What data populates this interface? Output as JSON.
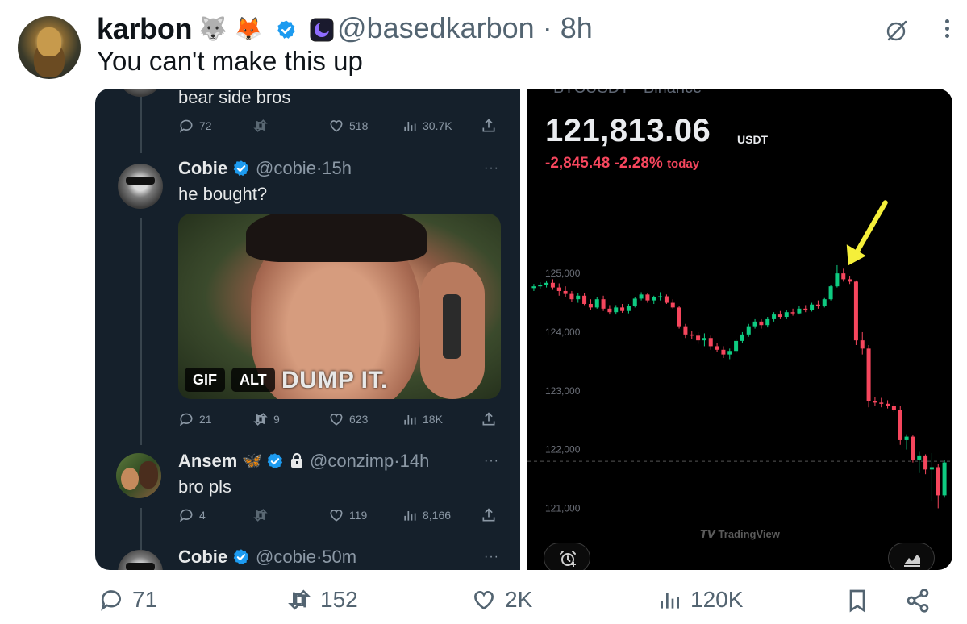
{
  "tweet": {
    "display_name": "karbon",
    "emojis": [
      "🐺",
      "🦊"
    ],
    "handle": "@basedkarbon",
    "separator": "·",
    "time": "8h",
    "text": "You can't make this up",
    "actions": {
      "replies": "71",
      "reposts": "152",
      "likes": "2K",
      "views": "120K"
    },
    "icons": [
      "grok-icon",
      "more-icon",
      "reply-icon",
      "repost-icon",
      "like-icon",
      "views-icon",
      "bookmark-icon",
      "share-icon"
    ]
  },
  "left_panel": {
    "top_reply": {
      "text": "bear side bros",
      "replies": "72",
      "reposts": "",
      "likes": "518",
      "views": "30.7K"
    },
    "reply_cobie": {
      "name": "Cobie",
      "handle": "@cobie",
      "time": "15h",
      "text": "he bought?",
      "gif_badge": "GIF",
      "alt_badge": "ALT",
      "gif_caption": "DUMP IT.",
      "replies": "21",
      "reposts": "9",
      "likes": "623",
      "views": "18K"
    },
    "reply_ansem": {
      "name": "Ansem",
      "name_emoji": "🦋",
      "handle": "@conzimp",
      "time": "14h",
      "text": "bro pls",
      "replies": "4",
      "reposts": "",
      "likes": "119",
      "views": "8,166"
    },
    "reply_cobie_2": {
      "name": "Cobie",
      "handle": "@cobie",
      "time": "50m"
    },
    "more_dots": "···",
    "separator": "·"
  },
  "right_panel": {
    "top_cut_text": "BTCUSDT · Binance",
    "price": "121,813.06",
    "unit": "USDT",
    "change_abs": "-2,845.48",
    "change_pct": "-2.28%",
    "change_label": "today",
    "watermark": "TradingView",
    "accent_colors": {
      "up": "#0ecb81",
      "down": "#f6465d",
      "arrow": "#f5ef3a"
    }
  },
  "chart_data": {
    "type": "candlestick",
    "title": "",
    "ylabel": "",
    "yticks": [
      "125,000",
      "124,000",
      "123,000",
      "122,000",
      "121,000"
    ],
    "ylim": [
      120800,
      125400
    ],
    "reference_line": 121800,
    "grid": false,
    "annotation": "yellow arrow pointing at local top",
    "candles": [
      {
        "o": 124750,
        "h": 124820,
        "l": 124700,
        "c": 124780
      },
      {
        "o": 124780,
        "h": 124850,
        "l": 124740,
        "c": 124800
      },
      {
        "o": 124800,
        "h": 124880,
        "l": 124760,
        "c": 124840
      },
      {
        "o": 124840,
        "h": 124900,
        "l": 124720,
        "c": 124760
      },
      {
        "o": 124760,
        "h": 124830,
        "l": 124620,
        "c": 124700
      },
      {
        "o": 124700,
        "h": 124780,
        "l": 124600,
        "c": 124650
      },
      {
        "o": 124650,
        "h": 124700,
        "l": 124520,
        "c": 124560
      },
      {
        "o": 124560,
        "h": 124660,
        "l": 124500,
        "c": 124620
      },
      {
        "o": 124620,
        "h": 124660,
        "l": 124460,
        "c": 124480
      },
      {
        "o": 124480,
        "h": 124560,
        "l": 124380,
        "c": 124420
      },
      {
        "o": 124420,
        "h": 124600,
        "l": 124400,
        "c": 124560
      },
      {
        "o": 124560,
        "h": 124620,
        "l": 124360,
        "c": 124400
      },
      {
        "o": 124400,
        "h": 124460,
        "l": 124300,
        "c": 124340
      },
      {
        "o": 124340,
        "h": 124460,
        "l": 124300,
        "c": 124420
      },
      {
        "o": 124420,
        "h": 124480,
        "l": 124330,
        "c": 124360
      },
      {
        "o": 124360,
        "h": 124480,
        "l": 124320,
        "c": 124450
      },
      {
        "o": 124450,
        "h": 124600,
        "l": 124420,
        "c": 124570
      },
      {
        "o": 124570,
        "h": 124680,
        "l": 124540,
        "c": 124640
      },
      {
        "o": 124640,
        "h": 124660,
        "l": 124500,
        "c": 124540
      },
      {
        "o": 124540,
        "h": 124620,
        "l": 124480,
        "c": 124590
      },
      {
        "o": 124590,
        "h": 124680,
        "l": 124540,
        "c": 124610
      },
      {
        "o": 124610,
        "h": 124640,
        "l": 124480,
        "c": 124500
      },
      {
        "o": 124500,
        "h": 124560,
        "l": 124400,
        "c": 124420
      },
      {
        "o": 124420,
        "h": 124450,
        "l": 124060,
        "c": 124100
      },
      {
        "o": 124100,
        "h": 124140,
        "l": 123900,
        "c": 123960
      },
      {
        "o": 123960,
        "h": 124020,
        "l": 123880,
        "c": 123940
      },
      {
        "o": 123940,
        "h": 124000,
        "l": 123800,
        "c": 123860
      },
      {
        "o": 123860,
        "h": 123980,
        "l": 123760,
        "c": 123900
      },
      {
        "o": 123900,
        "h": 123940,
        "l": 123700,
        "c": 123760
      },
      {
        "o": 123760,
        "h": 123820,
        "l": 123660,
        "c": 123700
      },
      {
        "o": 123700,
        "h": 123760,
        "l": 123560,
        "c": 123620
      },
      {
        "o": 123620,
        "h": 123720,
        "l": 123540,
        "c": 123680
      },
      {
        "o": 123680,
        "h": 123880,
        "l": 123640,
        "c": 123850
      },
      {
        "o": 123850,
        "h": 124000,
        "l": 123820,
        "c": 123960
      },
      {
        "o": 123960,
        "h": 124140,
        "l": 123920,
        "c": 124100
      },
      {
        "o": 124100,
        "h": 124220,
        "l": 124060,
        "c": 124180
      },
      {
        "o": 124180,
        "h": 124220,
        "l": 124060,
        "c": 124120
      },
      {
        "o": 124120,
        "h": 124260,
        "l": 124080,
        "c": 124220
      },
      {
        "o": 124220,
        "h": 124340,
        "l": 124180,
        "c": 124300
      },
      {
        "o": 124300,
        "h": 124360,
        "l": 124220,
        "c": 124260
      },
      {
        "o": 124260,
        "h": 124380,
        "l": 124220,
        "c": 124340
      },
      {
        "o": 124340,
        "h": 124400,
        "l": 124280,
        "c": 124320
      },
      {
        "o": 124320,
        "h": 124440,
        "l": 124300,
        "c": 124400
      },
      {
        "o": 124400,
        "h": 124460,
        "l": 124340,
        "c": 124380
      },
      {
        "o": 124380,
        "h": 124500,
        "l": 124350,
        "c": 124470
      },
      {
        "o": 124470,
        "h": 124540,
        "l": 124400,
        "c": 124440
      },
      {
        "o": 124440,
        "h": 124580,
        "l": 124420,
        "c": 124560
      },
      {
        "o": 124560,
        "h": 124800,
        "l": 124540,
        "c": 124780
      },
      {
        "o": 124780,
        "h": 125140,
        "l": 124760,
        "c": 125000
      },
      {
        "o": 125000,
        "h": 125080,
        "l": 124860,
        "c": 124900
      },
      {
        "o": 124900,
        "h": 124960,
        "l": 124820,
        "c": 124860
      },
      {
        "o": 124860,
        "h": 124880,
        "l": 123780,
        "c": 123860
      },
      {
        "o": 123860,
        "h": 124000,
        "l": 123620,
        "c": 123720
      },
      {
        "o": 123720,
        "h": 123780,
        "l": 122720,
        "c": 122820
      },
      {
        "o": 122820,
        "h": 122900,
        "l": 122740,
        "c": 122800
      },
      {
        "o": 122800,
        "h": 122880,
        "l": 122720,
        "c": 122780
      },
      {
        "o": 122780,
        "h": 122840,
        "l": 122700,
        "c": 122740
      },
      {
        "o": 122740,
        "h": 122800,
        "l": 122640,
        "c": 122680
      },
      {
        "o": 122680,
        "h": 122740,
        "l": 122080,
        "c": 122160
      },
      {
        "o": 122160,
        "h": 122260,
        "l": 122000,
        "c": 122220
      },
      {
        "o": 122220,
        "h": 122240,
        "l": 121780,
        "c": 121820
      },
      {
        "o": 121820,
        "h": 121960,
        "l": 121600,
        "c": 121900
      },
      {
        "o": 121900,
        "h": 121920,
        "l": 121580,
        "c": 121660
      },
      {
        "o": 121660,
        "h": 121940,
        "l": 121120,
        "c": 121700
      },
      {
        "o": 121700,
        "h": 121760,
        "l": 121000,
        "c": 121220
      },
      {
        "o": 121220,
        "h": 121820,
        "l": 121180,
        "c": 121780
      }
    ]
  }
}
